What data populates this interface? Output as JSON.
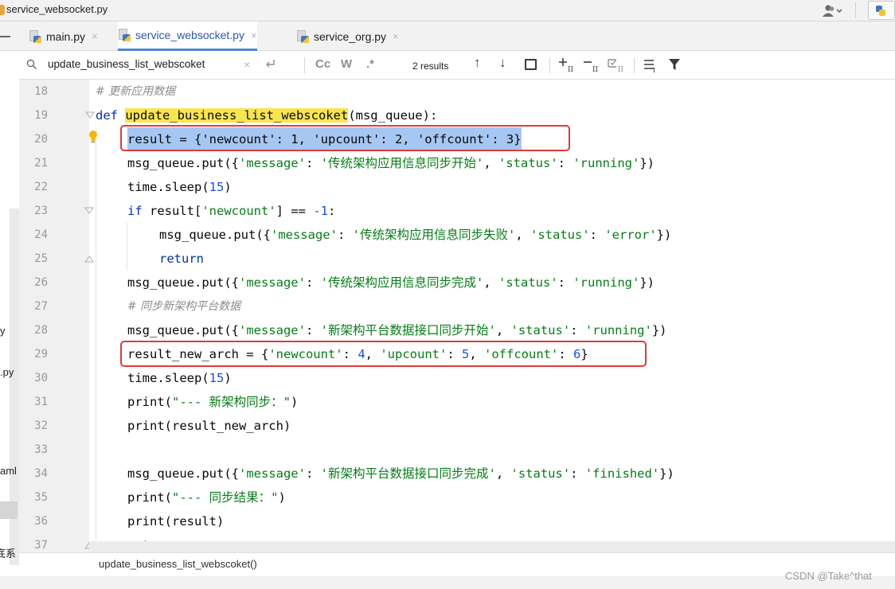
{
  "window": {
    "title": "service_websocket.py"
  },
  "tabs": [
    {
      "label": "main.py",
      "active": false
    },
    {
      "label": "service_websocket.py",
      "active": true
    },
    {
      "label": "service_org.py",
      "active": false
    }
  ],
  "search": {
    "query": "update_business_list_webscoket",
    "results_count": "2 results",
    "match_case_label": "Cc",
    "words_label": "W",
    "regex_label": ".*"
  },
  "project_strip": {
    "fragments": [
      "y",
      ".py",
      "aml",
      "底系"
    ]
  },
  "editor": {
    "lines": [
      {
        "num": "18",
        "comment": "# 更新应用数据"
      },
      {
        "num": "19",
        "def_kw": "def",
        "fn_name": "update_business_list_webscoket",
        "params": "(msg_queue):"
      },
      {
        "num": "20",
        "text": "result = {'newcount': 1, 'upcount': 2, 'offcount': 3}"
      },
      {
        "num": "21",
        "pre": "msg_queue.put({",
        "k1": "'message'",
        "mid": ": ",
        "v1": "'传统架构应用信息同步开始'",
        "sep": ", ",
        "k2": "'status'",
        "v2": "'running'",
        "post": "})"
      },
      {
        "num": "22",
        "pre": "time.sleep(",
        "n": "15",
        "post": ")"
      },
      {
        "num": "23",
        "kw": "if",
        "a": " result[",
        "s": "'newcount'",
        "b": "] == ",
        "n": "-1",
        "c": ":"
      },
      {
        "num": "24",
        "pre": "msg_queue.put({",
        "k1": "'message'",
        "mid": ": ",
        "v1": "'传统架构应用信息同步失败'",
        "sep": ", ",
        "k2": "'status'",
        "v2": "'error'",
        "post": "})"
      },
      {
        "num": "25",
        "kw": "return"
      },
      {
        "num": "26",
        "pre": "msg_queue.put({",
        "k1": "'message'",
        "mid": ": ",
        "v1": "'传统架构应用信息同步完成'",
        "sep": ", ",
        "k2": "'status'",
        "v2": "'running'",
        "post": "})"
      },
      {
        "num": "27",
        "comment": "# 同步新架构平台数据"
      },
      {
        "num": "28",
        "pre": "msg_queue.put({",
        "k1": "'message'",
        "mid": ": ",
        "v1": "'新架构平台数据接口同步开始'",
        "sep": ", ",
        "k2": "'status'",
        "v2": "'running'",
        "post": "})"
      },
      {
        "num": "29",
        "pre": "result_new_arch = {",
        "k1": "'newcount'",
        "n1": "4",
        "k2": "'upcount'",
        "n2": "5",
        "k3": "'offcount'",
        "n3": "6",
        "post": "}"
      },
      {
        "num": "30",
        "pre": "time.sleep(",
        "n": "15",
        "post": ")"
      },
      {
        "num": "31",
        "pre": "print(",
        "s": "\"--- 新架构同步：\"",
        "post": ")"
      },
      {
        "num": "32",
        "text": "print(result_new_arch)"
      },
      {
        "num": "33"
      },
      {
        "num": "34",
        "pre": "msg_queue.put({",
        "k1": "'message'",
        "mid": ": ",
        "v1": "'新架构平台数据接口同步完成'",
        "sep": ", ",
        "k2": "'status'",
        "v2": "'finished'",
        "post": "})"
      },
      {
        "num": "35",
        "pre": "print(",
        "s": "\"--- 同步结果：\"",
        "post": ")"
      },
      {
        "num": "36",
        "text": "print(result)"
      },
      {
        "num": "37",
        "kw": "return"
      }
    ]
  },
  "breadcrumb": "update_business_list_webscoket()",
  "watermark": "CSDN @Take^that",
  "colors": {
    "keyword": "#0033b3",
    "string": "#067d17",
    "number": "#1750eb",
    "comment": "#8c8c8c",
    "search_highlight": "#f9e54e",
    "selection": "#a6c7f2",
    "annotation_box": "#e03a3a"
  }
}
